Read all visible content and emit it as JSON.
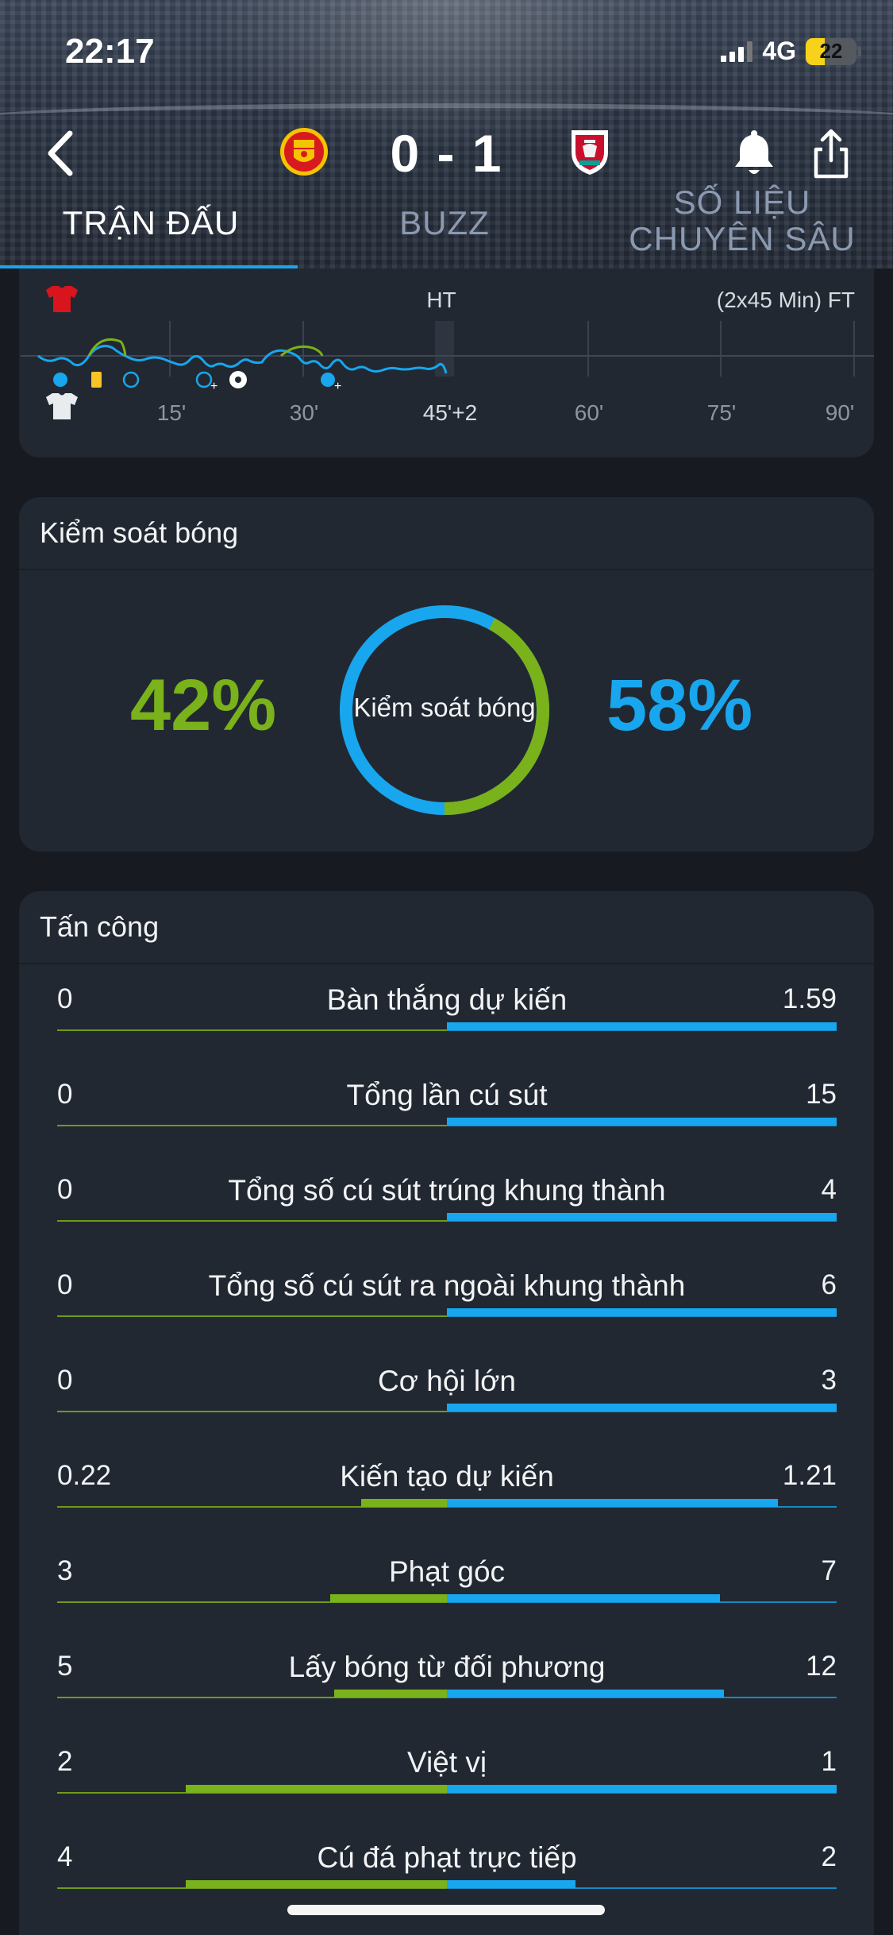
{
  "status_bar": {
    "time": "22:17",
    "network": "4G",
    "battery": "22"
  },
  "match": {
    "score": "0 - 1",
    "home_team": "Manchester United",
    "away_team": "Liverpool"
  },
  "tabs": [
    {
      "label": "TRẬN ĐẤU",
      "active": true
    },
    {
      "label": "BUZZ",
      "active": false
    },
    {
      "label": "SỐ LIỆU CHUYÊN SÂU",
      "active": false
    }
  ],
  "timeline": {
    "ht_label": "HT",
    "ft_label": "(2x45 Min) FT",
    "ticks": [
      "15'",
      "30'",
      "45'+2",
      "60'",
      "75'",
      "90'"
    ]
  },
  "possession": {
    "title": "Kiểm soát bóng",
    "center_label": "Kiểm soát bóng",
    "home": "42%",
    "away": "58%",
    "home_value": 42,
    "away_value": 58,
    "home_color": "#79b21a",
    "away_color": "#18a6ee"
  },
  "attack": {
    "title": "Tấn công",
    "rows": [
      {
        "label": "Bàn thắng dự kiến",
        "home": "0",
        "away": "1.59",
        "home_share": 0,
        "away_share": 1.0
      },
      {
        "label": "Tổng lần cú sút",
        "home": "0",
        "away": "15",
        "home_share": 0,
        "away_share": 1.0
      },
      {
        "label": "Tổng số cú sút trúng khung thành",
        "home": "0",
        "away": "4",
        "home_share": 0,
        "away_share": 1.0
      },
      {
        "label": "Tổng số cú sút ra ngoài khung thành",
        "home": "0",
        "away": "6",
        "home_share": 0,
        "away_share": 1.0
      },
      {
        "label": "Cơ hội lớn",
        "home": "0",
        "away": "3",
        "home_share": 0,
        "away_share": 1.0
      },
      {
        "label": "Kiến tạo dự kiến",
        "home": "0.22",
        "away": "1.21",
        "home_share": 0.22,
        "away_share": 0.85
      },
      {
        "label": "Phạt góc",
        "home": "3",
        "away": "7",
        "home_share": 0.3,
        "away_share": 0.7
      },
      {
        "label": "Lấy bóng từ đối phương",
        "home": "5",
        "away": "12",
        "home_share": 0.29,
        "away_share": 0.71
      },
      {
        "label": "Việt vị",
        "home": "2",
        "away": "1",
        "home_share": 0.67,
        "away_share": 1.0
      },
      {
        "label": "Cú đá phạt trực tiếp",
        "home": "4",
        "away": "2",
        "home_share": 0.67,
        "away_share": 0.33
      }
    ]
  }
}
